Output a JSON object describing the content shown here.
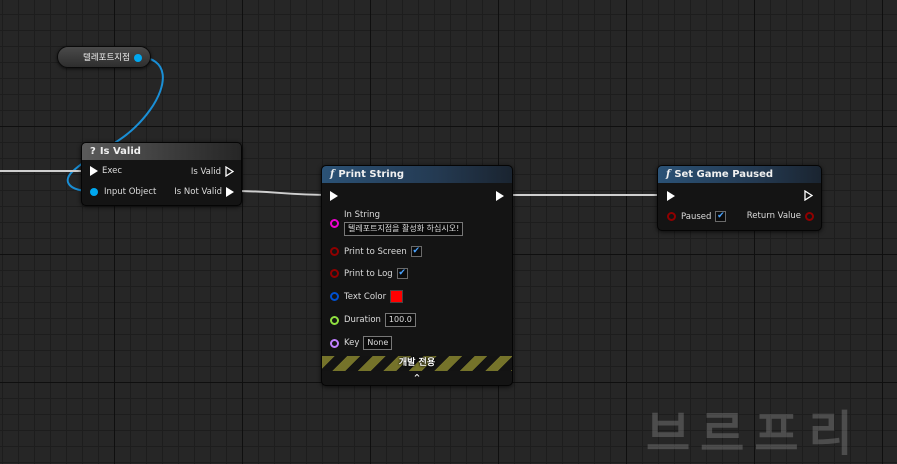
{
  "variable_node": {
    "label": "텔레포트지점"
  },
  "is_valid_node": {
    "title": "Is Valid",
    "header_glyph": "?",
    "pins": {
      "exec": "Exec",
      "input_object": "Input Object",
      "is_valid": "Is Valid",
      "is_not_valid": "Is Not Valid"
    }
  },
  "print_string_node": {
    "title": "Print String",
    "header_glyph": "f",
    "pins": {
      "in_string": "In String",
      "in_string_value": "텔레포트지점을 활성화 하십시오!",
      "print_to_screen": "Print to Screen",
      "print_to_screen_checked": "✔",
      "print_to_log": "Print to Log",
      "print_to_log_checked": "✔",
      "text_color": "Text Color",
      "text_color_value": "#ff0000",
      "duration": "Duration",
      "duration_value": "100.0",
      "key": "Key",
      "key_value": "None"
    },
    "dev_only_label": "개발 전용",
    "expand_icon": "⌃"
  },
  "set_game_paused_node": {
    "title": "Set Game Paused",
    "header_glyph": "f",
    "pins": {
      "paused": "Paused",
      "paused_checked": "✔",
      "return_value": "Return Value"
    }
  },
  "watermark": "브르프리",
  "colors": {
    "graph_background": "#262626",
    "object_pin": "#00a8f0",
    "string_pin": "#f000d0",
    "bool_pin": "#900000",
    "struct_pin": "#0050d0",
    "float_pin": "#90e040",
    "name_pin": "#c080ff",
    "exec_pin": "#ffffff"
  }
}
